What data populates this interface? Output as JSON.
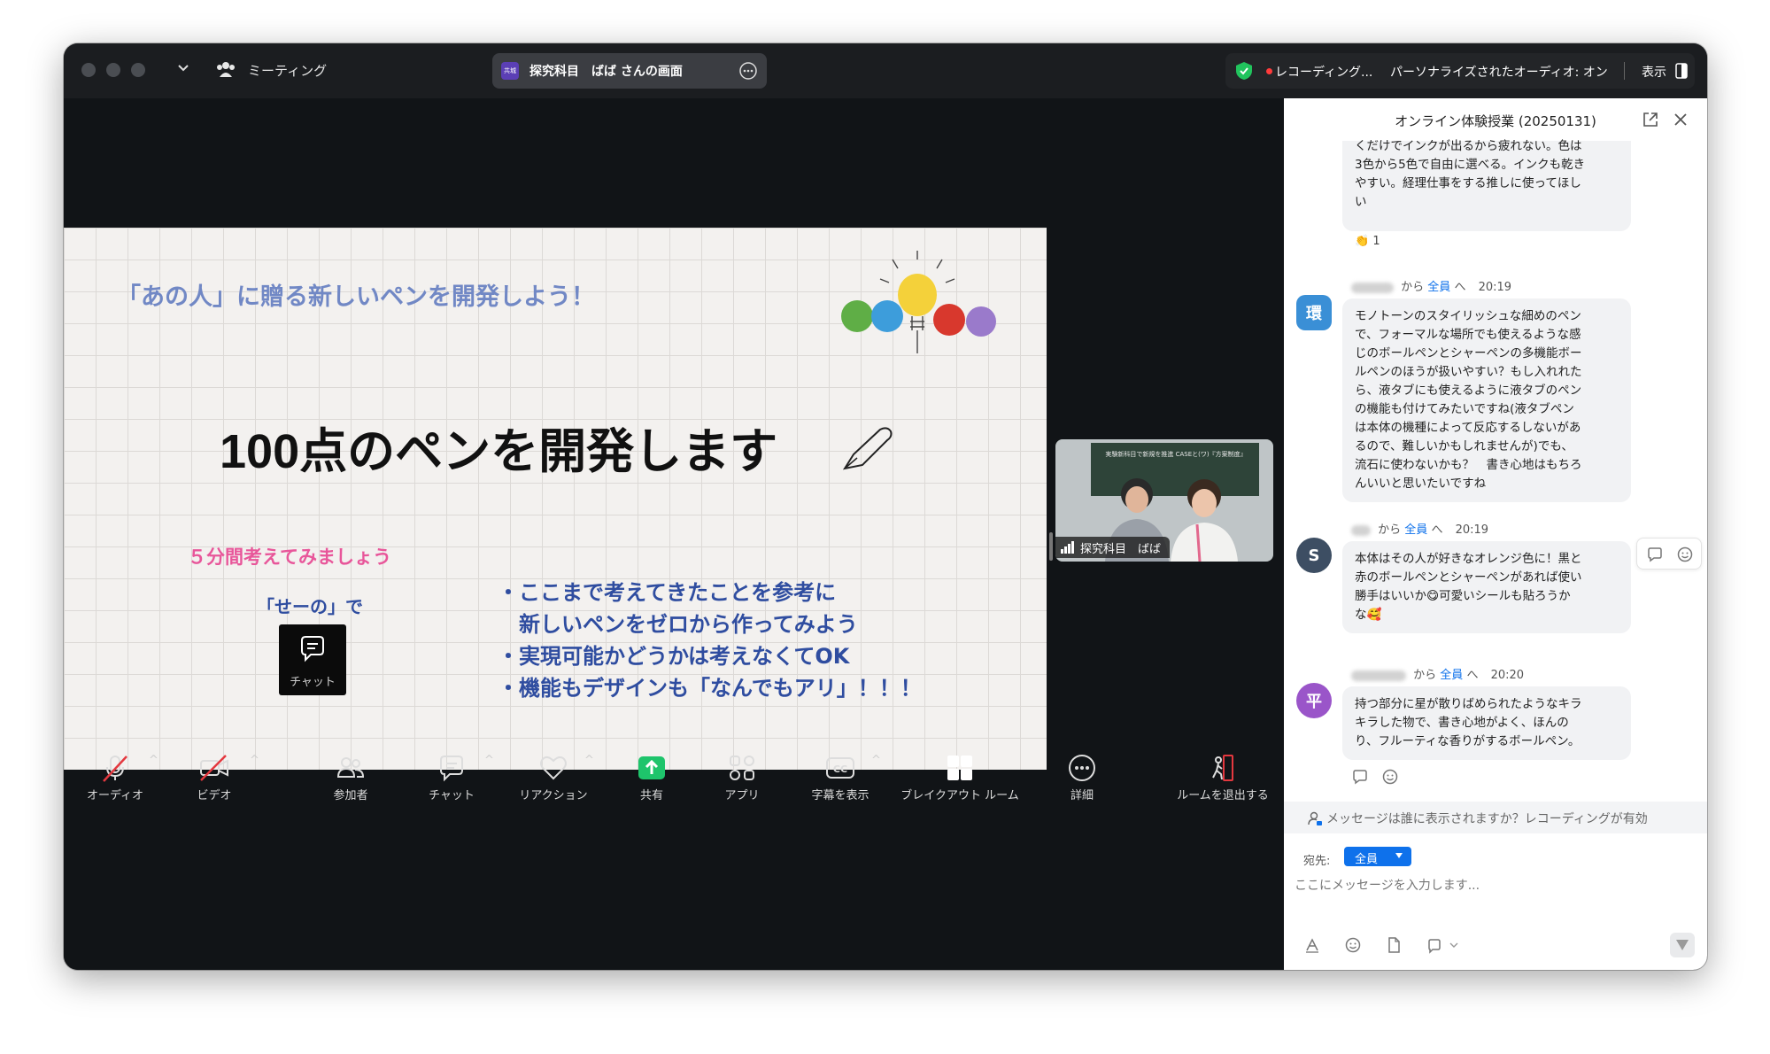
{
  "titlebar": {
    "meeting_label": "ミーティング",
    "share_badge": "共城",
    "share_title": "探究科目　ばば さんの画面",
    "recording": "レコーディング...",
    "audio": "パーソナライズされたオーディオ: オン",
    "view": "表示"
  },
  "slide": {
    "headline": "「あの人」に贈る新しいペンを開発しよう！",
    "title": "100点のペンを開発します",
    "think_label": "５分間考えてみましょう",
    "seno_label": "「せーの」で",
    "chat_badge": "チャット",
    "bullets": [
      "・ここまで考えてきたことを参考に",
      "　新しいペンをゼロから作ってみよう",
      "・実現可能かどうかは考えなくてOK",
      "・機能もデザインも「なんでもアリ」！！！"
    ]
  },
  "thumbnail": {
    "name": "探究科目　ばば",
    "board_text": "実験新科目で新規を推進 CASEと(ワ)『方案制度』"
  },
  "controls": {
    "audio": "オーディオ",
    "video": "ビデオ",
    "participants": "参加者",
    "chat": "チャット",
    "reactions": "リアクション",
    "share": "共有",
    "apps": "アプリ",
    "captions": "字幕を表示",
    "breakout": "ブレイクアウト ルーム",
    "more": "詳細",
    "leave": "ルームを退出する"
  },
  "chat": {
    "title": "オンライン体験授業 (20250131)",
    "top_message": [
      "くだけでインクが出るから疲れない。色は",
      "3色から5色で自由に選べる。インクも乾き",
      "やすい。経理仕事をする推しに使ってほし",
      "い"
    ],
    "top_reaction": "👏 1",
    "messages": [
      {
        "avatar": "環",
        "avatar_color": "#3a8fd6",
        "from_word": "から",
        "to": "全員",
        "arrow": "へ",
        "time": "20:19",
        "lines": [
          "モノトーンのスタイリッシュな細めのペン",
          "で、フォーマルな場所でも使えるような感",
          "じのボールペンとシャーペンの多機能ボー",
          "ルペンのほうが扱いやすい？もし入れれた",
          "ら、液タブにも使えるように液タブのペン",
          "の機能も付けてみたいですね(液タブペン",
          "は本体の機種によって反応するしないがあ",
          "るので、難しいかもしれませんが)でも、",
          "流石に使わないかも？　書き心地はもちろ",
          "んいいと思いたいですね"
        ]
      },
      {
        "avatar": "S",
        "avatar_color": "#3d4e63",
        "from_word": "から",
        "to": "全員",
        "arrow": "へ",
        "time": "20:19",
        "lines": [
          "本体はその人が好きなオレンジ色に！黒と",
          "赤のボールペンとシャーペンがあれば使い",
          "勝手はいいか😋可愛いシールも貼ろうか",
          "な🥰"
        ]
      },
      {
        "avatar": "平",
        "avatar_color": "#9a55c9",
        "from_word": "から",
        "to": "全員",
        "arrow": "へ",
        "time": "20:20",
        "lines": [
          "持つ部分に星が散りばめられたようなキラ",
          "キラした物で、書き心地がよく、ほんの",
          "り、フルーティな香りがするボールペン。"
        ]
      }
    ],
    "visibility_notice": "メッセージは誰に表示されますか？レコーディングが有効",
    "to_label": "宛先:",
    "to_value": "全員",
    "input_placeholder": "ここにメッセージを入力します..."
  },
  "colors": {
    "accent_blue": "#0e71eb",
    "share_green": "#1ec46b",
    "slide_blue": "#2f4da0",
    "slide_pink": "#e8569a"
  }
}
